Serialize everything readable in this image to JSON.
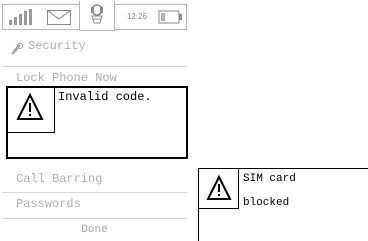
{
  "status_bar": {
    "time": "12:26",
    "signal_icon": "signal-bars-icon",
    "message_icon": "envelope-icon",
    "accessory_icon": "headset-icon",
    "battery_icon": "battery-icon"
  },
  "menu": {
    "title": "Security",
    "title_icon": "key-icon",
    "items": [
      {
        "label": "Lock Phone Now"
      },
      {
        "label": "Call Barring"
      },
      {
        "label": "Passwords"
      }
    ],
    "done_label": "Done"
  },
  "dialogs": {
    "invalid_code": {
      "message": "Invalid code.",
      "icon": "warning-icon"
    },
    "sim_blocked": {
      "line1": "SIM card",
      "line2": "blocked",
      "icon": "warning-icon"
    }
  },
  "colors": {
    "disabled_text": "#b0b0b0",
    "border": "#000000"
  }
}
